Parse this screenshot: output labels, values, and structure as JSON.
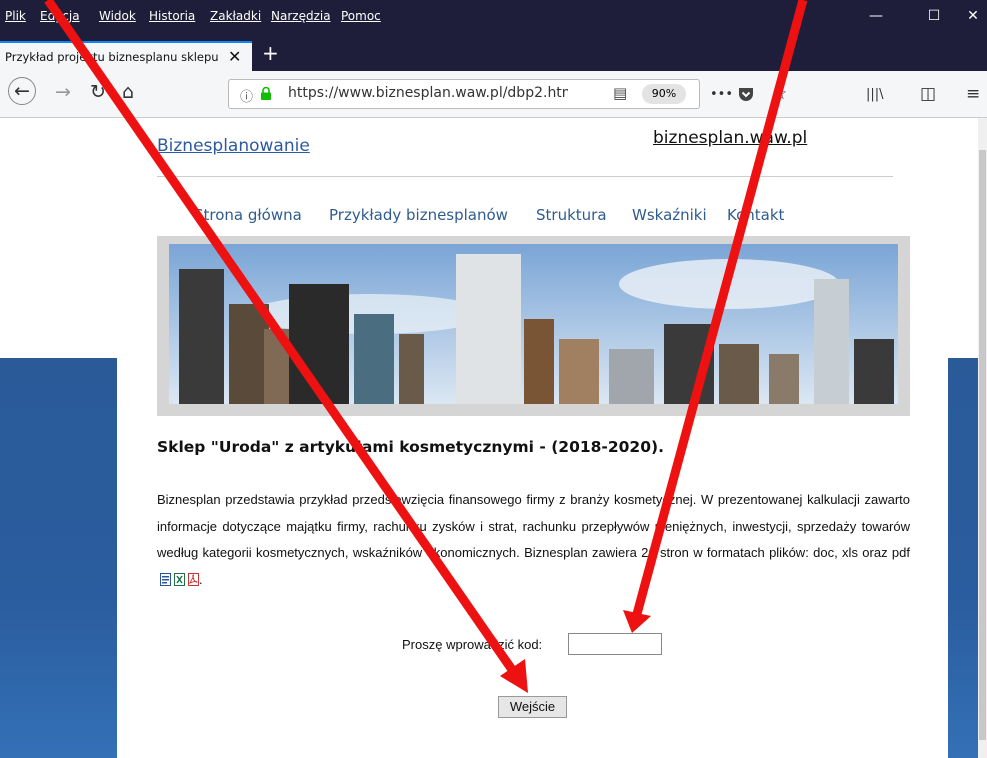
{
  "menubar": {
    "items": [
      "Plik",
      "Edycja",
      "Widok",
      "Historia",
      "Zakładki",
      "Narzędzia",
      "Pomoc"
    ],
    "minimize": "—",
    "maximize": "☐",
    "close": "✕"
  },
  "tab": {
    "title": "Przykład projektu biznesplanu sklepu",
    "close": "✕",
    "new_tab": "+"
  },
  "nav": {
    "back": "←",
    "forward": "→",
    "reload": "↻",
    "home": "⌂",
    "info": "ⓘ",
    "url": "https://www.biznesplan.waw.pl/dbp2.htm",
    "reader": "▤",
    "zoom": "90%",
    "more": "•••",
    "pocket": "pocket-icon",
    "star": "☆",
    "library": "|||\\",
    "sidebar": "◫",
    "menu": "≡"
  },
  "page": {
    "site_link": "Biznesplanowanie",
    "domain_link": "biznesplan.waw.pl",
    "nav_links": [
      "Strona główna",
      "Przykłady biznesplanów",
      "Struktura",
      "Wskaźniki",
      "Kontakt"
    ],
    "heading": "Sklep \"Uroda\" z artykułami kosmetycznymi - (2018-2020).",
    "description": "Biznesplan przedstawia przykład przedsięwzięcia finansowego firmy z branży kosmetycznej. W prezentowanej kalkulacji zawarto informacje dotyczące majątku firmy, rachunku zysków i strat, rachunku przepływów pieniężnych, inwestycji, sprzedaży towarów według kategorii kosmetycznych, wskaźników ekonomicznych. Biznesplan zawiera 26 stron w formatach plików: doc, xls oraz pdf",
    "file_icons": [
      "word-icon",
      "excel-icon",
      "pdf-icon"
    ],
    "desc_end": ".",
    "code_label": "Proszę  wprowadzić kod:",
    "code_value": "",
    "submit_label": "Wejście"
  },
  "colors": {
    "annotation_arrow": "#ee1111",
    "link": "#2c5aa0",
    "background": "#2a5d9f"
  }
}
